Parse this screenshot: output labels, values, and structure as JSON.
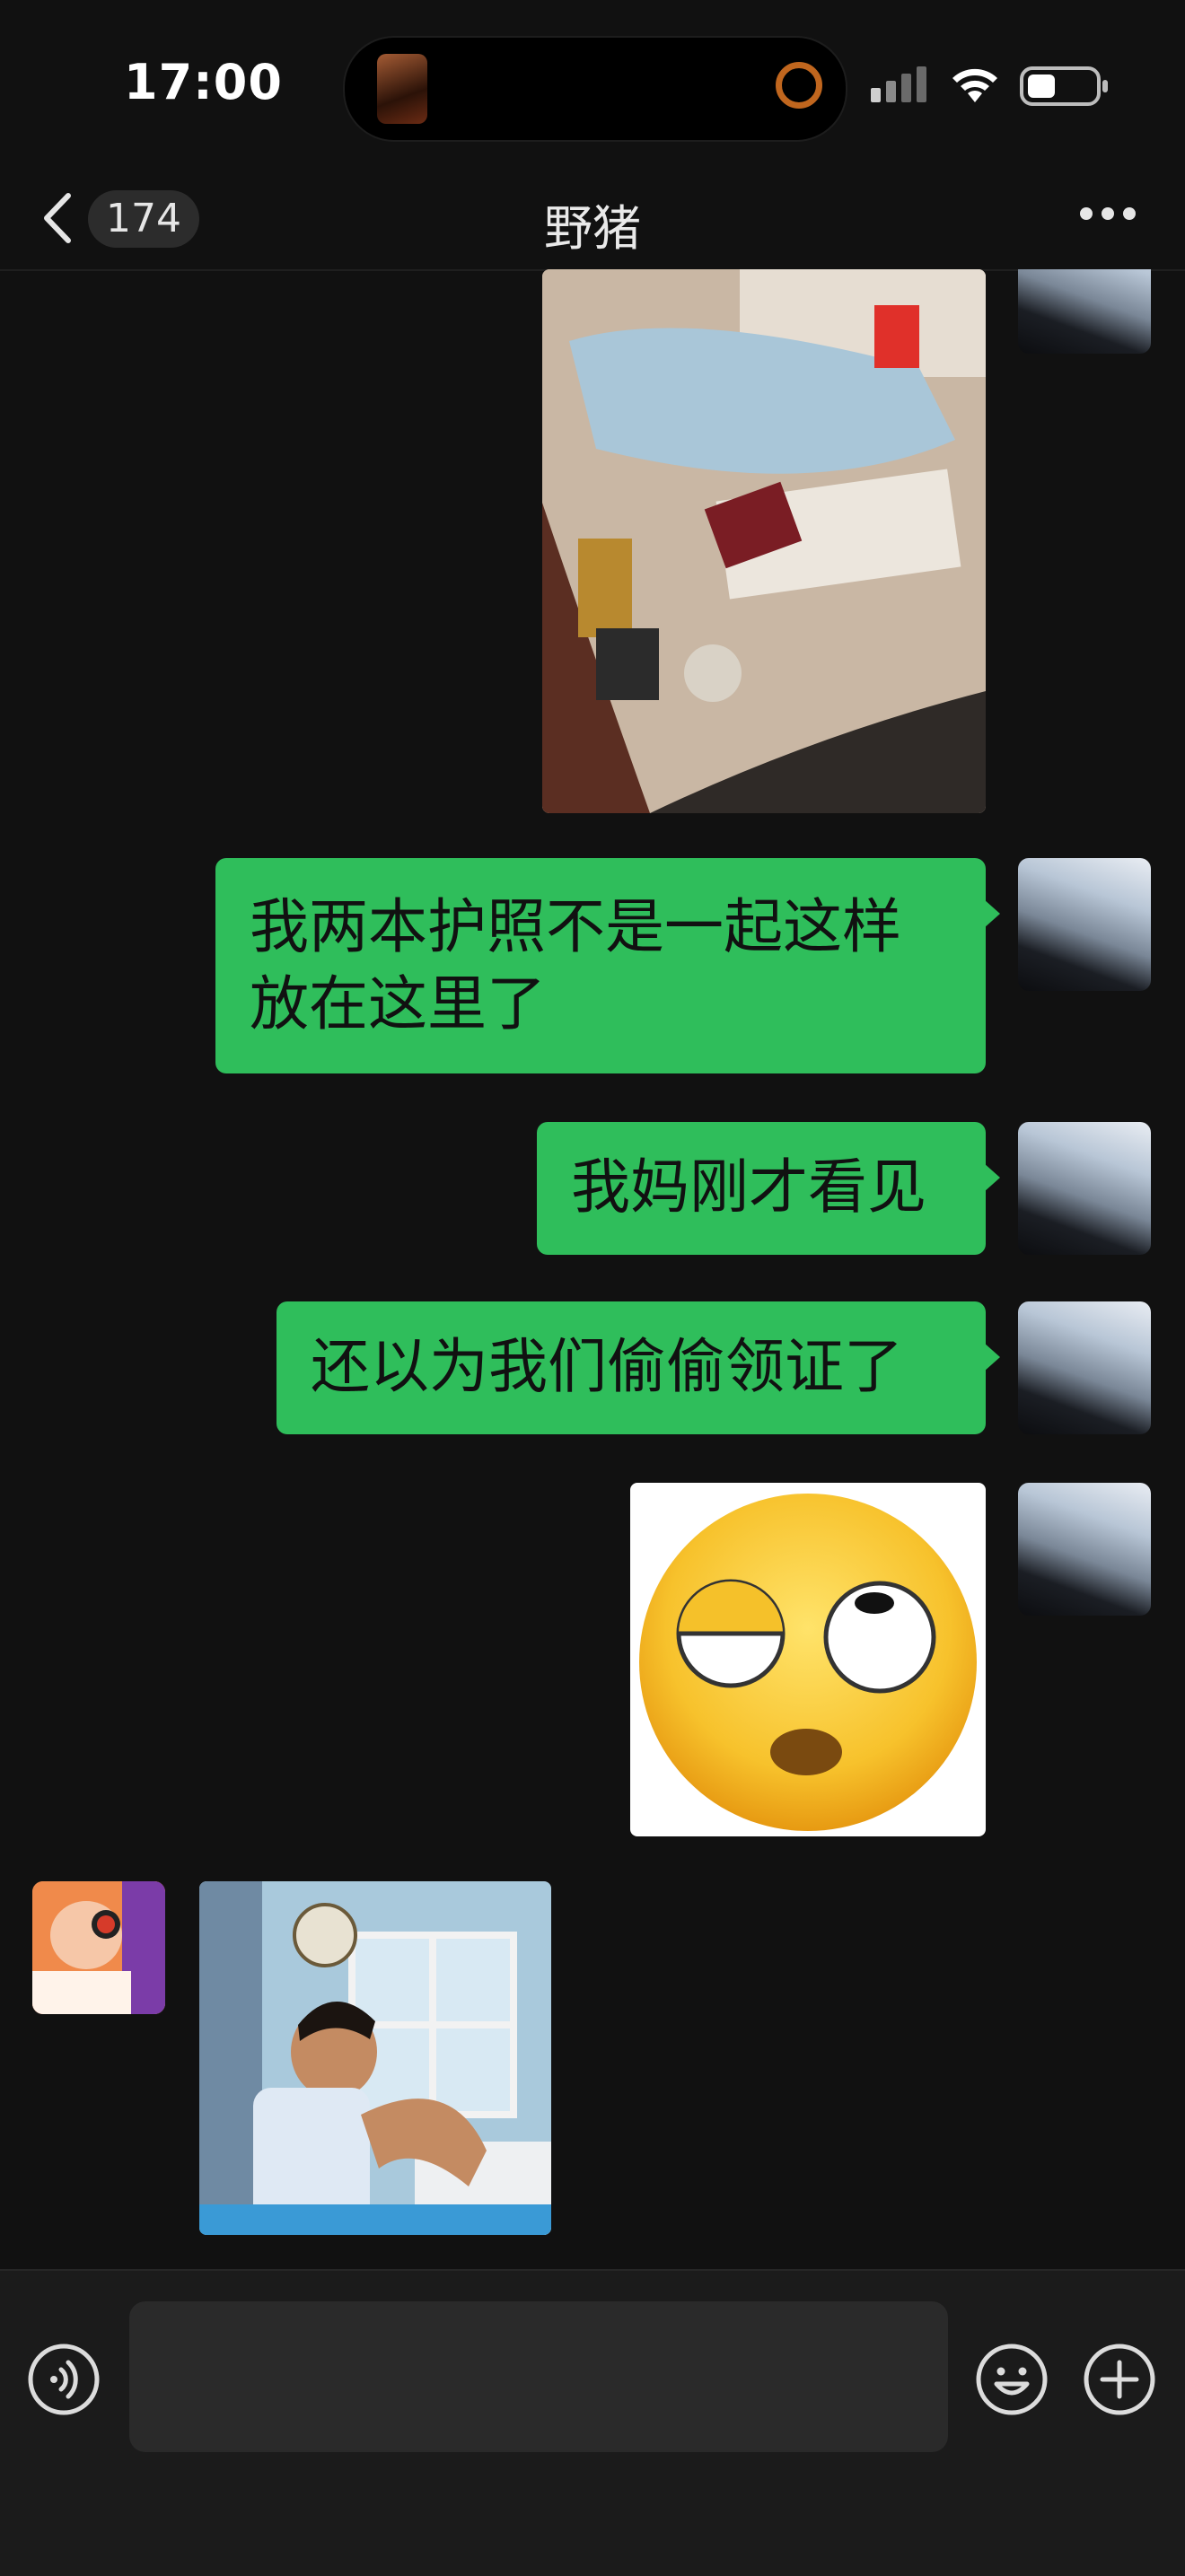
{
  "status_bar": {
    "time": "17:00"
  },
  "nav": {
    "unread_count": "174",
    "title": "野猪"
  },
  "messages": [
    {
      "type": "image",
      "sender": "me",
      "description_icon": "photo-icon"
    },
    {
      "type": "text",
      "sender": "me",
      "line1": "我两本护照不是一起这样",
      "line2": "放在这里了"
    },
    {
      "type": "text",
      "sender": "me",
      "text": "我妈刚才看见"
    },
    {
      "type": "text",
      "sender": "me",
      "text": "还以为我们偷偷领证了"
    },
    {
      "type": "sticker",
      "sender": "me",
      "icon": "rolling-eyes-emoji"
    },
    {
      "type": "sticker",
      "sender": "peer",
      "icon": "crying-boy-meme"
    }
  ],
  "input_bar": {
    "placeholder": ""
  },
  "colors": {
    "bubble": "#2fbe5b",
    "background": "#111111",
    "input_bar": "#1b1b1b"
  }
}
